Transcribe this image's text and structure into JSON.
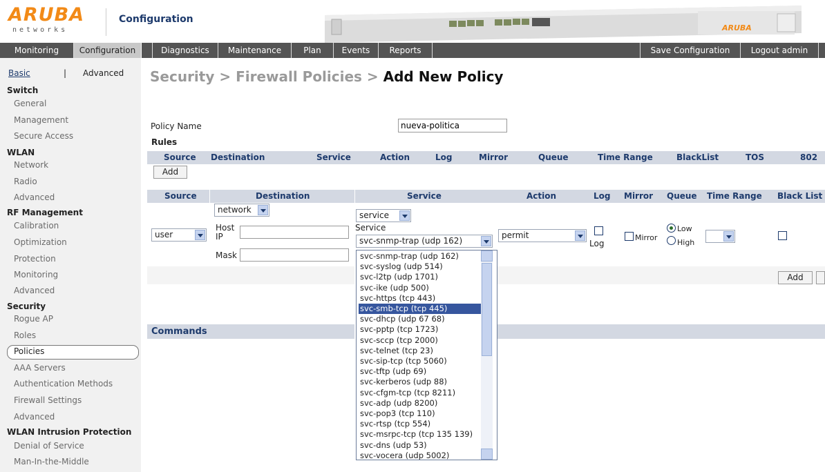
{
  "header": {
    "brand": "ARUBA",
    "brand_sub": "networks",
    "section_title": "Configuration",
    "device_brand": "ARUBA"
  },
  "nav": {
    "tabs": [
      "Monitoring",
      "Configuration",
      "Diagnostics",
      "Maintenance",
      "Plan",
      "Events",
      "Reports"
    ],
    "active_tab": "Configuration",
    "save_label": "Save Configuration",
    "logout_label": "Logout admin"
  },
  "sidebar": {
    "basic": "Basic",
    "sep": "|",
    "advanced": "Advanced",
    "sections": [
      {
        "title": "Switch",
        "items": [
          "General",
          "Management",
          "Secure Access"
        ]
      },
      {
        "title": "WLAN",
        "items": [
          "Network",
          "Radio",
          "Advanced"
        ]
      },
      {
        "title": "RF Management",
        "items": [
          "Calibration",
          "Optimization",
          "Protection",
          "Monitoring",
          "Advanced"
        ]
      },
      {
        "title": "Security",
        "items": [
          "Rogue AP",
          "Roles",
          "Policies",
          "AAA Servers",
          "Authentication Methods",
          "Firewall Settings",
          "Advanced"
        ]
      },
      {
        "title": "WLAN Intrusion Protection",
        "items": [
          "Denial of Service",
          "Man-In-the-Middle"
        ]
      }
    ],
    "selected": "Policies"
  },
  "main": {
    "breadcrumb_prefix": "Security > Firewall Policies > ",
    "breadcrumb_current": "Add New Policy",
    "policy_name_label": "Policy Name",
    "policy_name_value": "nueva-politica",
    "rules_label": "Rules",
    "rules_columns": [
      "Source",
      "Destination",
      "Service",
      "Action",
      "Log",
      "Mirror",
      "Queue",
      "Time Range",
      "BlackList",
      "TOS",
      "802"
    ],
    "add_label": "Add",
    "edit_columns": [
      "Source",
      "Destination",
      "Service",
      "Action",
      "Log",
      "Mirror",
      "Queue",
      "Time Range",
      "Black List"
    ],
    "source_value": "user",
    "destination_type": "network",
    "host_ip_label_1": "Host",
    "host_ip_label_2": "IP",
    "mask_label": "Mask",
    "service_type": "service",
    "service_label": "Service",
    "service_value": "svc-snmp-trap (udp 162)",
    "action_value": "permit",
    "log_label": "Log",
    "mirror_label": "Mirror",
    "queue_low": "Low",
    "queue_high": "High",
    "add_rule_label": "Add",
    "commands_label": "Commands"
  },
  "service_options": [
    "svc-snmp-trap (udp 162)",
    "svc-syslog (udp 514)",
    "svc-l2tp (udp 1701)",
    "svc-ike (udp 500)",
    "svc-https (tcp 443)",
    "svc-smb-tcp (tcp 445)",
    "svc-dhcp (udp 67 68)",
    "svc-pptp (tcp 1723)",
    "svc-sccp (tcp 2000)",
    "svc-telnet (tcp 23)",
    "svc-sip-tcp (tcp 5060)",
    "svc-tftp (udp 69)",
    "svc-kerberos (udp 88)",
    "svc-cfgm-tcp (tcp 8211)",
    "svc-adp (udp 8200)",
    "svc-pop3 (tcp 110)",
    "svc-rtsp (tcp 554)",
    "svc-msrpc-tcp (tcp 135 139)",
    "svc-dns (udp 53)",
    "svc-vocera (udp 5002)"
  ],
  "service_highlighted": "svc-smb-tcp (tcp 445)",
  "colors": {
    "brand_orange": "#f28a17",
    "nav_bg": "#545454",
    "header_row": "#d3d8e2",
    "highlight": "#36569e",
    "title_blue": "#1d3a6c"
  }
}
